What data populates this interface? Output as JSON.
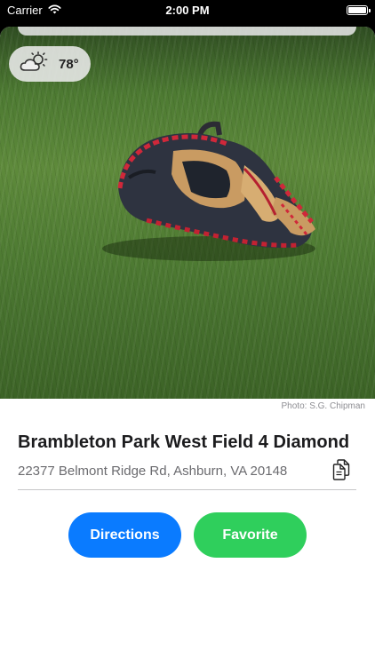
{
  "status_bar": {
    "carrier": "Carrier",
    "time": "2:00 PM"
  },
  "weather": {
    "icon": "partly-sunny-icon",
    "temperature": "78°"
  },
  "photo": {
    "subject": "baseball-glove-on-grass",
    "credit": "Photo: S.G. Chipman"
  },
  "place": {
    "name": "Brambleton Park West Field 4 Diamond",
    "address": "22377 Belmont Ridge Rd, Ashburn, VA 20148"
  },
  "actions": {
    "directions_label": "Directions",
    "favorite_label": "Favorite"
  },
  "colors": {
    "directions_blue": "#0a7bff",
    "favorite_green": "#2fcf5c",
    "status_bar_bg": "#000000"
  }
}
